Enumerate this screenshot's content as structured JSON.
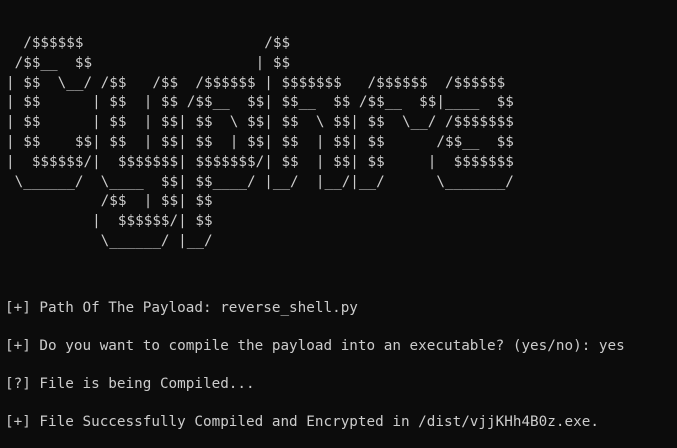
{
  "banner": {
    "lines": [
      "  /$$$$$$                     /$$",
      " /$$__  $$                   | $$",
      "| $$  \\__/ /$$   /$$  /$$$$$$ | $$$$$$$   /$$$$$$  /$$$$$$",
      "| $$      | $$  | $$ /$$__  $$| $$__  $$ /$$__  $$|____  $$",
      "| $$      | $$  | $$| $$  \\ $$| $$  \\ $$| $$  \\__/ /$$$$$$$",
      "| $$    $$| $$  | $$| $$  | $$| $$  | $$| $$      /$$__  $$",
      "|  $$$$$$/|  $$$$$$$| $$$$$$$/| $$  | $$| $$     |  $$$$$$$",
      " \\______/  \\____  $$| $$____/ |__/  |__/|__/      \\_______/",
      "           /$$  | $$| $$",
      "          |  $$$$$$/| $$",
      "           \\______/ |__/"
    ]
  },
  "output": {
    "line1": {
      "prefix": "[+]",
      "text": " Path Of The Payload: reverse_shell.py"
    },
    "line2": {
      "prefix": "[+]",
      "text": " Do you want to compile the payload into an executable? (yes/no): yes"
    },
    "line3": {
      "prefix": "[?]",
      "text": " File is being Compiled..."
    },
    "line4": {
      "prefix": "[+]",
      "text": " File Successfully Compiled and Encrypted in /dist/vjjKHh4B0z.exe."
    }
  }
}
